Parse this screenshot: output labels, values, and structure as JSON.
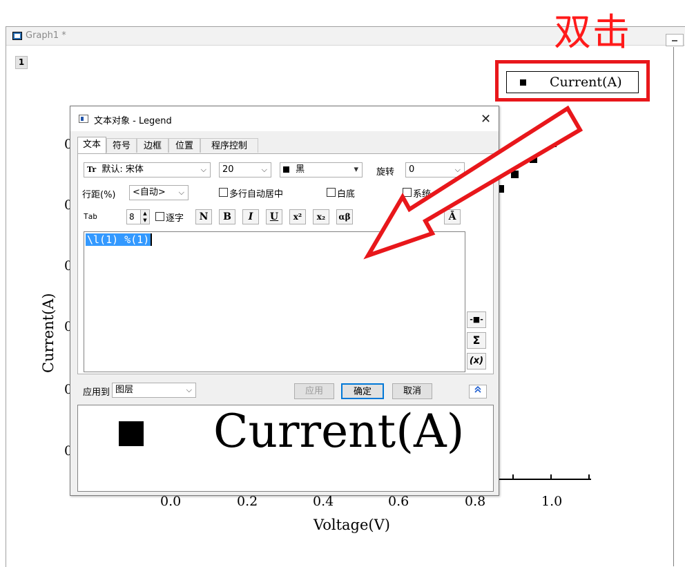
{
  "graph_window": {
    "title": "Graph1 *",
    "layer_label": "1"
  },
  "annotation": {
    "text": "双击",
    "color": "#e8171b"
  },
  "legend": {
    "label": "Current(A)"
  },
  "axes": {
    "y_title": "Current(A)",
    "x_title": "Voltage(V)",
    "x_ticks": [
      "0.0",
      "0.2",
      "0.4",
      "0.6",
      "0.8",
      "1.0"
    ],
    "y_ticks_partial": [
      "0",
      "0",
      "0",
      "0",
      "0",
      "0"
    ]
  },
  "dialog": {
    "title": "文本对象 - Legend",
    "close_glyph": "✕",
    "tabs": [
      "文本",
      "符号",
      "边框",
      "位置",
      "程序控制"
    ],
    "font_combo": "默认: 宋体",
    "font_icon_glyph": "Tr",
    "size_combo": "20",
    "color_combo": "黑",
    "rotate_label": "旋转",
    "rotate_value": "0",
    "line_spacing_label": "行距(%)",
    "line_spacing_value": "<自动>",
    "multiline_center_label": "多行自动居中",
    "white_bg_label": "白底",
    "system_label_partial": "系统",
    "tab_label": "Tab",
    "tab_value": "8",
    "per_char_label": "逐字",
    "format_buttons": [
      "N",
      "B",
      "I",
      "U",
      "x²",
      "x₂",
      "αβ",
      "Ā"
    ],
    "editor_text": "\\l(1) %(1)",
    "side_buttons": [
      "-■-",
      "Σ",
      "(x)"
    ],
    "apply_to_label": "应用到",
    "apply_to_value": "图层",
    "apply_button": "应用",
    "ok_button": "确定",
    "cancel_button": "取消",
    "collapse_glyph": "⌃⌃",
    "preview_text": "Current(A)"
  },
  "icons": {
    "chevron": "⌵",
    "dropdown": "▾"
  }
}
